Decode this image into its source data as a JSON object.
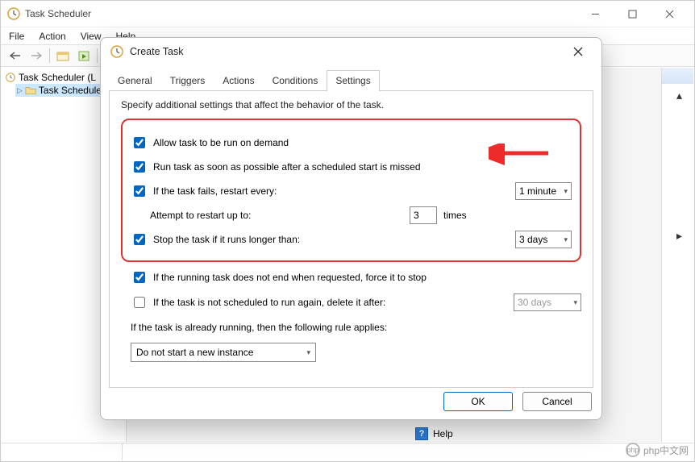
{
  "parent": {
    "title": "Task Scheduler",
    "menu": [
      "File",
      "Action",
      "View",
      "Help"
    ],
    "tree": {
      "root": "Task Scheduler (L",
      "child": "Task Schedule"
    },
    "help_label": "Help"
  },
  "dialog": {
    "title": "Create Task",
    "tabs": [
      "General",
      "Triggers",
      "Actions",
      "Conditions",
      "Settings"
    ],
    "active_tab": "Settings",
    "instruction": "Specify additional settings that affect the behavior of the task.",
    "settings": {
      "allow_on_demand": {
        "label": "Allow task to be run on demand",
        "checked": true
      },
      "run_asap": {
        "label": "Run task as soon as possible after a scheduled start is missed",
        "checked": true
      },
      "restart": {
        "label": "If the task fails, restart every:",
        "checked": true,
        "interval": "1 minute"
      },
      "attempts": {
        "label": "Attempt to restart up to:",
        "value": "3",
        "suffix": "times"
      },
      "stop_longer": {
        "label": "Stop the task if it runs longer than:",
        "checked": true,
        "duration": "3 days"
      },
      "force_stop": {
        "label": "If the running task does not end when requested, force it to stop",
        "checked": true
      },
      "delete_after": {
        "label": "If the task is not scheduled to run again, delete it after:",
        "checked": false,
        "duration": "30 days"
      },
      "rule_label": "If the task is already running, then the following rule applies:",
      "rule_value": "Do not start a new instance"
    },
    "buttons": {
      "ok": "OK",
      "cancel": "Cancel"
    }
  },
  "watermark": "php中文网"
}
